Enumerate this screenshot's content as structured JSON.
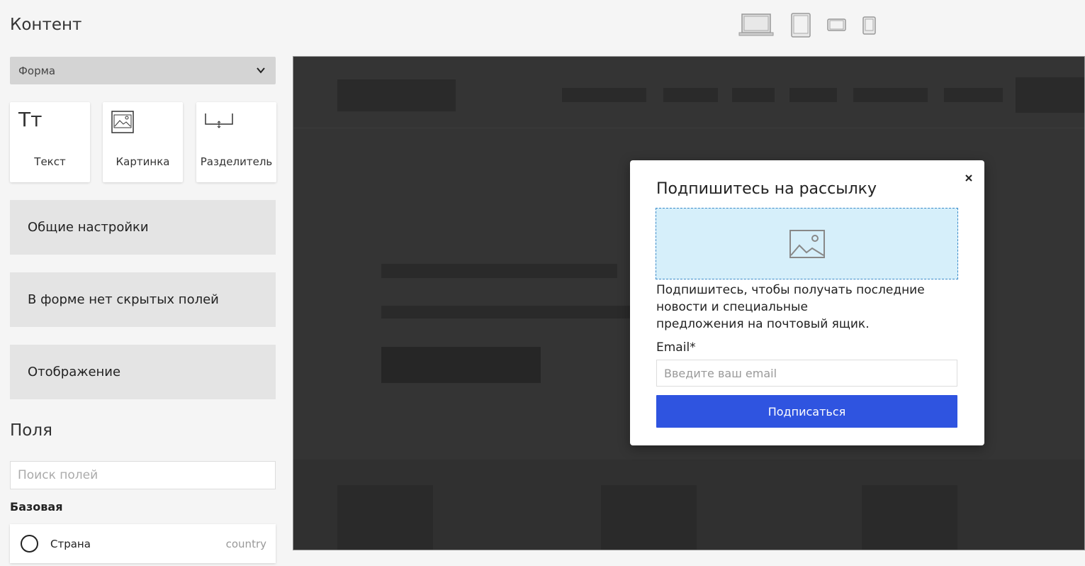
{
  "panel": {
    "title": "Контент",
    "type_select": {
      "value": "Форма"
    },
    "tiles": [
      {
        "label": "Текст",
        "icon": "text-icon",
        "glyph": "Тт"
      },
      {
        "label": "Картинка",
        "icon": "image-icon"
      },
      {
        "label": "Разделитель",
        "icon": "divider-icon"
      }
    ],
    "sections": [
      {
        "label": "Общие настройки"
      },
      {
        "label": "В форме нет скрытых полей"
      },
      {
        "label": "Отображение"
      }
    ],
    "fields": {
      "title": "Поля",
      "search_placeholder": "Поиск полей",
      "group": "Базовая",
      "items": [
        {
          "name": "Страна",
          "key": "country"
        }
      ]
    }
  },
  "devices": [
    {
      "name": "desktop",
      "icon": "laptop-icon",
      "active": true
    },
    {
      "name": "tablet-portrait",
      "icon": "tablet-icon"
    },
    {
      "name": "tablet-landscape",
      "icon": "tablet-landscape-icon"
    },
    {
      "name": "mobile",
      "icon": "phone-icon"
    }
  ],
  "modal": {
    "title": "Подпишитесь на рассылку",
    "description_lines": [
      "Подпишитесь, чтобы получать последние",
      "новости и специальные",
      "предложения на почтовый ящик."
    ],
    "email_label": "Email*",
    "email_placeholder": "Введите ваш email",
    "submit_label": "Подписаться"
  },
  "colors": {
    "accent": "#2f54e0",
    "preview_bg": "#343434",
    "image_placeholder_bg": "#d6effa"
  }
}
